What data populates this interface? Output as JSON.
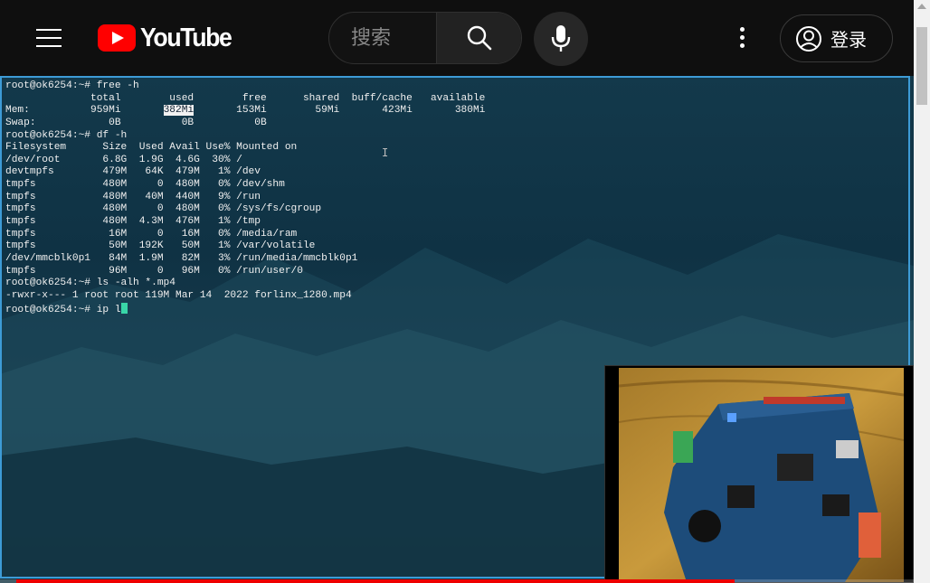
{
  "header": {
    "logo_text": "YouTube",
    "search_placeholder": "搜索",
    "signin_label": "登录"
  },
  "terminal": {
    "lines": [
      "root@ok6254:~# free -h",
      "              total        used        free      shared  buff/cache   available",
      "Mem:          959Mi       382Mi       153Mi        59Mi       423Mi       380Mi",
      "Swap:            0B          0B          0B",
      "root@ok6254:~# df -h",
      "Filesystem      Size  Used Avail Use% Mounted on",
      "/dev/root       6.8G  1.9G  4.6G  30% /",
      "devtmpfs        479M   64K  479M   1% /dev",
      "tmpfs           480M     0  480M   0% /dev/shm",
      "tmpfs           480M   40M  440M   9% /run",
      "tmpfs           480M     0  480M   0% /sys/fs/cgroup",
      "tmpfs           480M  4.3M  476M   1% /tmp",
      "tmpfs            16M     0   16M   0% /media/ram",
      "tmpfs            50M  192K   50M   1% /var/volatile",
      "/dev/mmcblk0p1   84M  1.9M   82M   3% /run/media/mmcblk0p1",
      "tmpfs            96M     0   96M   0% /run/user/0",
      "root@ok6254:~# ls -alh *.mp4",
      "-rwxr-x--- 1 root root 119M Mar 14  2022 forlinx_1280.mp4",
      "root@ok6254:~# ip l"
    ],
    "mem_used_highlight": "382Mi"
  },
  "player": {
    "progress_fraction": 0.8
  },
  "colors": {
    "accent": "#ff0000",
    "terminal_border": "#3d9bd6",
    "cursor": "#39d6a8"
  },
  "icons": {
    "menu": "hamburger-icon",
    "search": "search-icon",
    "mic": "microphone-icon",
    "more": "more-vertical-icon",
    "account": "account-icon"
  }
}
